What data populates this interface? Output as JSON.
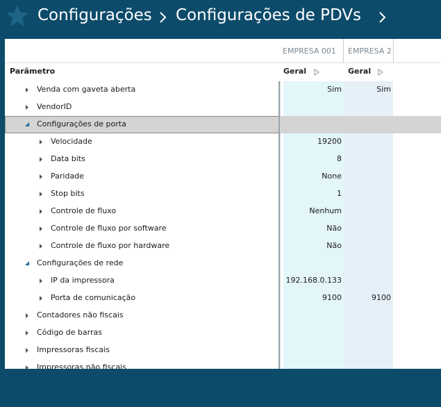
{
  "header": {
    "crumb1": "Configurações",
    "crumb2": "Configurações de PDVs"
  },
  "grid": {
    "columns": [
      "EMPRESA 001",
      "EMPRESA 2"
    ],
    "param_header": "Parâmetro",
    "group_headers": [
      "Geral",
      "Geral"
    ],
    "rows": [
      {
        "label": "Venda com gaveta aberta",
        "level": 1,
        "state": "collapsed",
        "v1": "Sim",
        "v2": "Sim"
      },
      {
        "label": "VendorID",
        "level": 1,
        "state": "collapsed",
        "v1": "",
        "v2": ""
      },
      {
        "label": "Configurações de porta",
        "level": 1,
        "state": "expanded",
        "v1": "",
        "v2": "",
        "selected": true
      },
      {
        "label": "Velocidade",
        "level": 2,
        "state": "collapsed",
        "v1": "19200",
        "v2": ""
      },
      {
        "label": "Data bits",
        "level": 2,
        "state": "collapsed",
        "v1": "8",
        "v2": ""
      },
      {
        "label": "Paridade",
        "level": 2,
        "state": "collapsed",
        "v1": "None",
        "v2": ""
      },
      {
        "label": "Stop bits",
        "level": 2,
        "state": "collapsed",
        "v1": "1",
        "v2": ""
      },
      {
        "label": "Controle de fluxo",
        "level": 2,
        "state": "collapsed",
        "v1": "Nenhum",
        "v2": ""
      },
      {
        "label": "Controle de fluxo por software",
        "level": 2,
        "state": "collapsed",
        "v1": "Não",
        "v2": ""
      },
      {
        "label": "Controle de fluxo por hardware",
        "level": 2,
        "state": "collapsed",
        "v1": "Não",
        "v2": ""
      },
      {
        "label": "Configurações de rede",
        "level": 1,
        "state": "expanded",
        "v1": "",
        "v2": ""
      },
      {
        "label": "IP da impressora",
        "level": 2,
        "state": "collapsed",
        "v1": "192.168.0.133",
        "v2": ""
      },
      {
        "label": "Porta de comunicação",
        "level": 2,
        "state": "collapsed",
        "v1": "9100",
        "v2": "9100"
      },
      {
        "label": "Contadores não fiscais",
        "level": 1,
        "state": "collapsed",
        "v1": "",
        "v2": ""
      },
      {
        "label": "Código de barras",
        "level": 1,
        "state": "collapsed",
        "v1": "",
        "v2": ""
      },
      {
        "label": "Impressoras fiscais",
        "level": 1,
        "state": "collapsed",
        "v1": "",
        "v2": ""
      },
      {
        "label": "Impressoras não fiscais",
        "level": 1,
        "state": "collapsed",
        "v1": "",
        "v2": ""
      }
    ]
  },
  "colors": {
    "header_bg": "#0d4b6b",
    "star": "#1d6486",
    "tint_col1": "#e3f6fa",
    "tint_col2": "#e6f0f9",
    "selected_row": "#d4d4d4"
  }
}
